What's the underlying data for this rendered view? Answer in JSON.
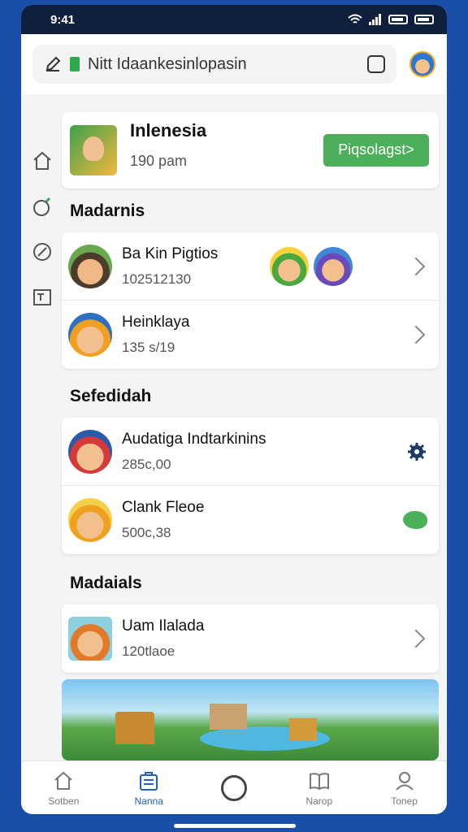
{
  "status": {
    "time": "9:41"
  },
  "topbar": {
    "url_text": "Nitt Idaankesinlopasin"
  },
  "sidebar": {
    "items": [
      {
        "icon": "home-icon"
      },
      {
        "icon": "bomb-icon"
      },
      {
        "icon": "compass-icon"
      },
      {
        "icon": "window-icon"
      }
    ]
  },
  "hero": {
    "title": "Inlenesia",
    "subtitle": "190 pam",
    "button_label": "Piqsolagst>"
  },
  "sections": [
    {
      "title": "Madarnis",
      "rows": [
        {
          "title": "Ba Kin Pigtios",
          "subtitle": "102512130",
          "action": "chevron"
        },
        {
          "title": "Heinklaya",
          "subtitle": "135 s/19",
          "action": "chevron"
        }
      ]
    },
    {
      "title": "Sefedidah",
      "rows": [
        {
          "title": "Audatiga Indtarkinins",
          "subtitle": "285c,00",
          "action": "gear"
        },
        {
          "title": "Clank Fleoe",
          "subtitle": "500c,38",
          "action": "blob"
        }
      ]
    },
    {
      "title": "Madaials",
      "rows": [
        {
          "title": "Uam Ilalada",
          "subtitle": "120tlaoe",
          "action": "chevron"
        }
      ]
    }
  ],
  "bottom_nav": [
    {
      "label": "Sotben",
      "icon": "home-icon"
    },
    {
      "label": "Nanna",
      "icon": "briefcase-icon",
      "active": true
    },
    {
      "label": "",
      "icon": "search-icon"
    },
    {
      "label": "Narop",
      "icon": "book-icon"
    },
    {
      "label": "Tonep",
      "icon": "profile-icon"
    }
  ],
  "colors": {
    "accent": "#1f5fbf",
    "green": "#4caf5a",
    "background": "#1a4fa8"
  }
}
